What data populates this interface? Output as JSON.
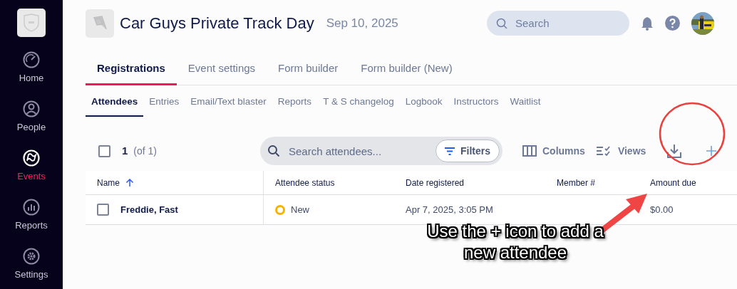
{
  "sidebar": {
    "items": [
      {
        "label": "Home",
        "selected": false
      },
      {
        "label": "People",
        "selected": false
      },
      {
        "label": "Events",
        "selected": true
      },
      {
        "label": "Reports",
        "selected": false
      },
      {
        "label": "Settings",
        "selected": false
      }
    ]
  },
  "event": {
    "title": "Car Guys Private Track Day",
    "date": "Sep 10, 2025"
  },
  "search": {
    "placeholder": "Search"
  },
  "tabs": [
    {
      "label": "Registrations",
      "selected": true
    },
    {
      "label": "Event settings",
      "selected": false
    },
    {
      "label": "Form builder",
      "selected": false
    },
    {
      "label": "Form builder (New)",
      "selected": false
    }
  ],
  "subtabs": [
    {
      "label": "Attendees",
      "selected": true
    },
    {
      "label": "Entries",
      "selected": false
    },
    {
      "label": "Email/Text blaster",
      "selected": false
    },
    {
      "label": "Reports",
      "selected": false
    },
    {
      "label": "T & S changelog",
      "selected": false
    },
    {
      "label": "Logbook",
      "selected": false
    },
    {
      "label": "Instructors",
      "selected": false
    },
    {
      "label": "Waitlist",
      "selected": false
    }
  ],
  "toolbar": {
    "select_all_checked": false,
    "count": "1",
    "total": "(of 1)",
    "search_placeholder": "Search attendees...",
    "filters": "Filters",
    "columns": "Columns",
    "views": "Views"
  },
  "table": {
    "columns": [
      {
        "label": "Name",
        "sorted": true
      },
      {
        "label": "Attendee status",
        "sorted": false
      },
      {
        "label": "Date registered",
        "sorted": false
      },
      {
        "label": "Member #",
        "sorted": false
      },
      {
        "label": "Amount due",
        "sorted": false
      }
    ],
    "rows": [
      {
        "checked": false,
        "name": "Freddie, Fast",
        "status": "New",
        "color": "#f5b300",
        "date": "Apr 7, 2025, 3:05 PM",
        "amount": "$0.00"
      }
    ]
  },
  "annotation": {
    "text": "Use the + icon to add a new attendee"
  }
}
